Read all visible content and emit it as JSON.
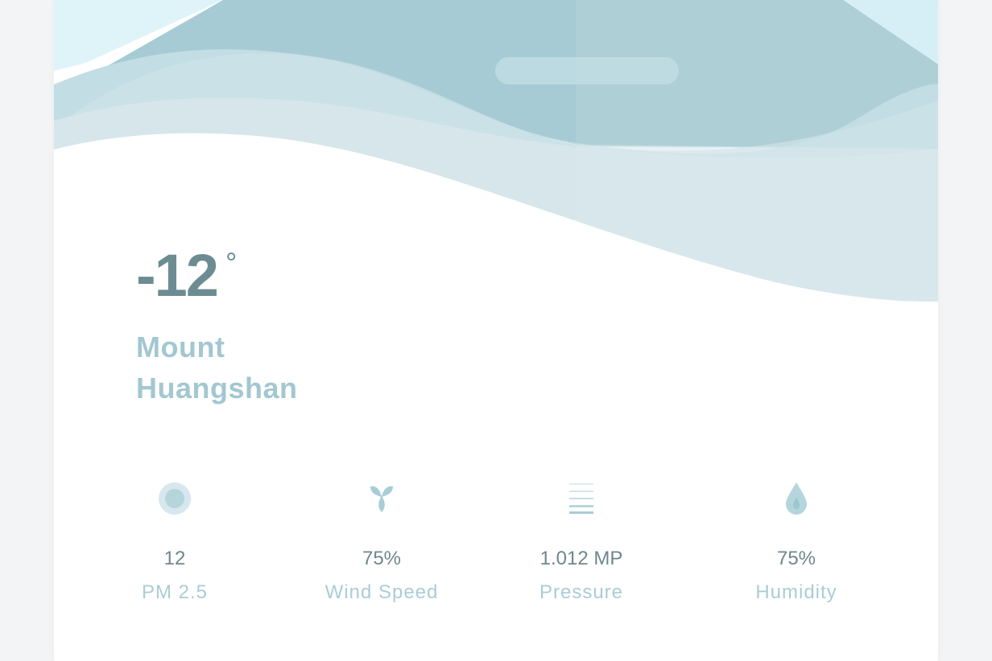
{
  "weather": {
    "temperature": "-12",
    "unit": "°",
    "location_line1": "Mount",
    "location_line2": "Huangshan"
  },
  "stats": [
    {
      "icon": "pm25-icon",
      "value": "12",
      "label": "PM 2.5"
    },
    {
      "icon": "wind-icon",
      "value": "75%",
      "label": "Wind Speed"
    },
    {
      "icon": "pressure-icon",
      "value": "1.012 MP",
      "label": "Pressure"
    },
    {
      "icon": "humidity-icon",
      "value": "75%",
      "label": "Humidity"
    }
  ],
  "colors": {
    "temperature": "#6c8c92",
    "location": "#a3c7d1",
    "stat_value": "#6f878c",
    "stat_label": "#a9cdd6",
    "hero_dark": "#a6cbd4",
    "hero_light": "#dbe8ed"
  }
}
